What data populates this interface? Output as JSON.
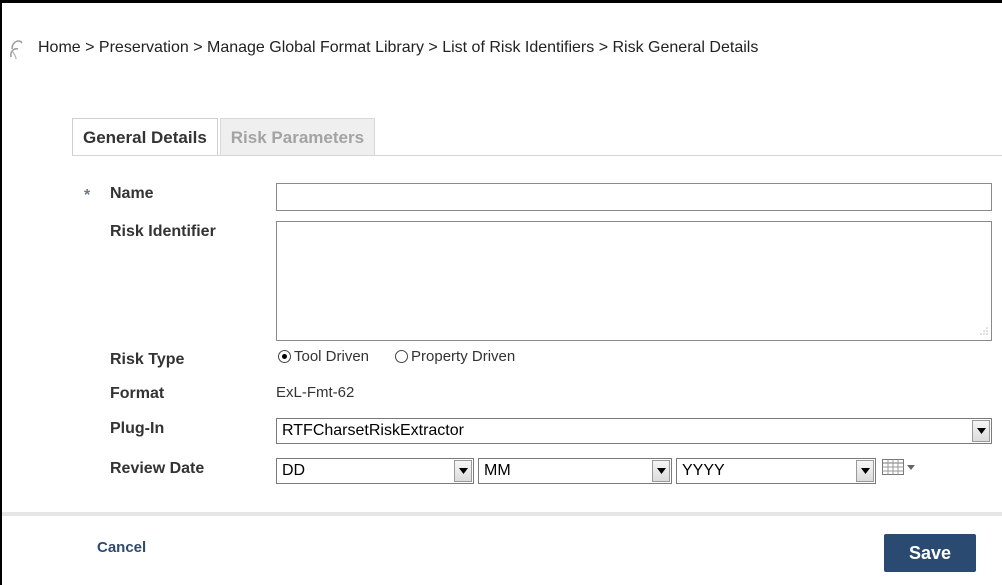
{
  "breadcrumb": {
    "items": [
      "Home",
      "Preservation",
      "Manage Global Format Library",
      "List of Risk Identifiers",
      "Risk General Details"
    ],
    "separator": " > "
  },
  "tabs": [
    {
      "label": "General Details",
      "active": true
    },
    {
      "label": "Risk Parameters",
      "active": false
    }
  ],
  "form": {
    "required_marker": "*",
    "name_label": "Name",
    "name_value": "",
    "risk_identifier_label": "Risk Identifier",
    "risk_identifier_value": "",
    "risk_type_label": "Risk Type",
    "risk_type_options": [
      {
        "label": "Tool Driven",
        "selected": true
      },
      {
        "label": "Property Driven",
        "selected": false
      }
    ],
    "format_label": "Format",
    "format_value": "ExL-Fmt-62",
    "plugin_label": "Plug-In",
    "plugin_value": "RTFCharsetRiskExtractor",
    "review_date_label": "Review Date",
    "review_day": "DD",
    "review_month": "MM",
    "review_year": "YYYY"
  },
  "footer": {
    "cancel_label": "Cancel",
    "save_label": "Save"
  },
  "colors": {
    "save_button": "#2b4a72",
    "cancel_link": "#2f4a6d",
    "inactive_tab_text": "#a3a3a3"
  }
}
